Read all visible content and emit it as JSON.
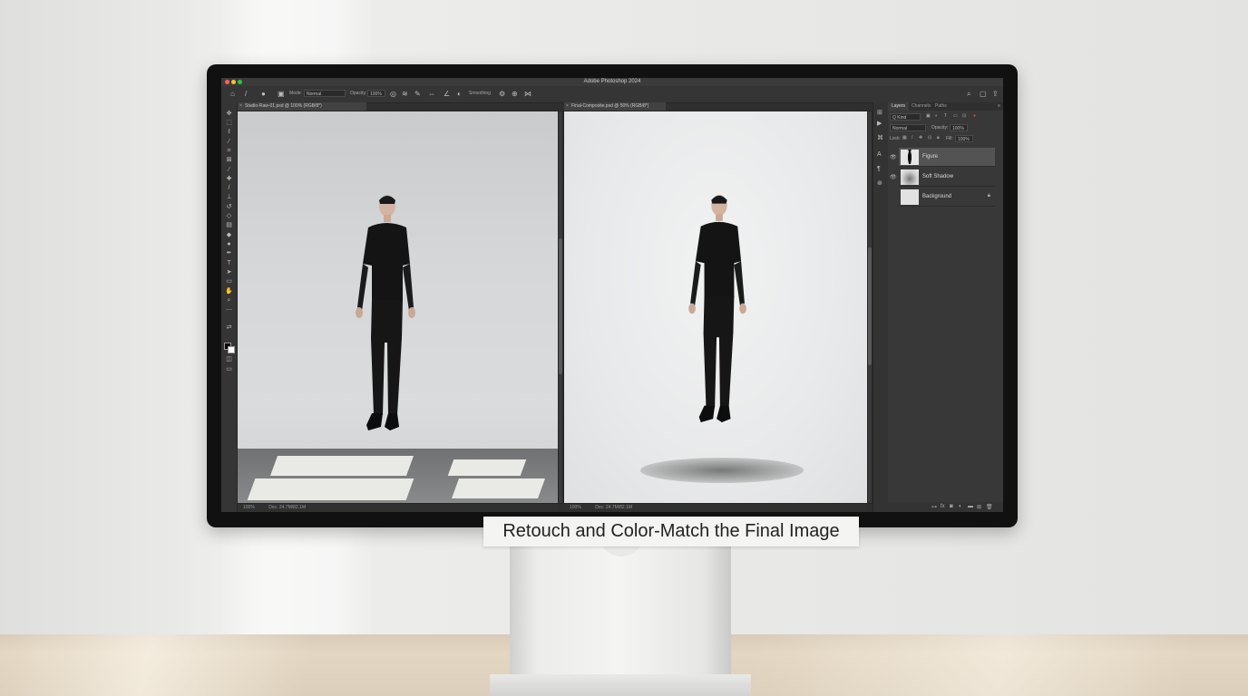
{
  "app": {
    "window_title": "Adobe Photoshop 2024"
  },
  "options_bar": {
    "mode_label": "Mode:",
    "mode_value": "Normal",
    "opacity_label": "Opacity:",
    "opacity_value": "100%",
    "smoothing_label": "Smoothing"
  },
  "documents": [
    {
      "tab_label": "Studio-Raw-01.psd @ 100% (RGB/8*)",
      "status": "100%",
      "status_doc": "Doc: 24.7M/82.1M"
    },
    {
      "tab_label": "Final-Composite.psd @ 50% (RGB/8*)",
      "status": "100%",
      "status_doc": "Doc: 24.7M/82.1M"
    }
  ],
  "panel": {
    "tabs": [
      "Layers",
      "Channels",
      "Paths"
    ],
    "kind_label": "Q Kind",
    "blend_value": "Normal",
    "opacity_label": "Opacity:",
    "opacity_value": "100%",
    "lock_label": "Lock:",
    "fill_label": "Fill:",
    "fill_value": "100%",
    "layers": [
      {
        "name": "Figure",
        "selected": true
      },
      {
        "name": "Soft Shadow",
        "selected": false
      },
      {
        "name": "Background",
        "selected": false,
        "locked": true
      }
    ]
  },
  "caption": "Retouch and Color-Match the Final Image",
  "colors": {
    "ui_dark": "#2f2f2f",
    "panel": "#383838",
    "selected_layer": "#535353",
    "traffic_red": "#ff5f57",
    "traffic_yellow": "#febc2e",
    "traffic_green": "#28c840"
  },
  "icons": {
    "tools": [
      "move-icon",
      "marquee-icon",
      "lasso-icon",
      "magic-wand-icon",
      "crop-icon",
      "frame-icon",
      "eyedropper-icon",
      "healing-icon",
      "brush-icon",
      "stamp-icon",
      "history-brush-icon",
      "eraser-icon",
      "gradient-icon",
      "blur-icon",
      "dodge-icon",
      "pen-icon",
      "type-icon",
      "path-select-icon",
      "shape-icon",
      "hand-icon",
      "zoom-icon",
      "more-icon"
    ]
  }
}
